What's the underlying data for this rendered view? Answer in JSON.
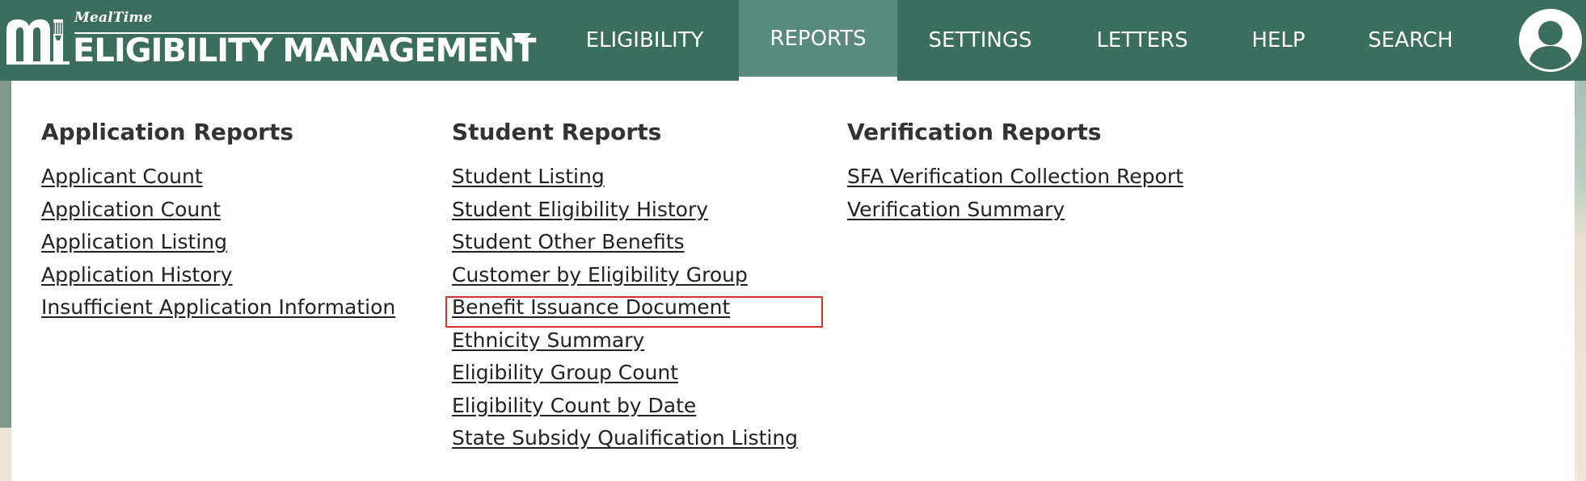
{
  "brand": {
    "small_text": "MealTime",
    "title": "ELIGIBILITY MANAGEMENT",
    "logo_icon": "mealtime-logo-icon",
    "caret_icon": "caret-down-icon"
  },
  "nav": {
    "items": [
      {
        "label": "ELIGIBILITY",
        "active": false
      },
      {
        "label": "REPORTS",
        "active": true
      },
      {
        "label": "SETTINGS",
        "active": false
      },
      {
        "label": "LETTERS",
        "active": false
      },
      {
        "label": "HELP",
        "active": false
      },
      {
        "label": "SEARCH",
        "active": false
      }
    ],
    "avatar_icon": "user-avatar-icon"
  },
  "menu": {
    "columns": [
      {
        "heading": "Application Reports",
        "links": [
          "Applicant Count",
          "Application Count",
          "Application Listing",
          "Application History",
          "Insufficient Application Information"
        ]
      },
      {
        "heading": "Student Reports",
        "links": [
          "Student Listing",
          "Student Eligibility History",
          "Student Other Benefits",
          "Customer by Eligibility Group",
          "Benefit Issuance Document",
          "Ethnicity Summary",
          "Eligibility Group Count",
          "Eligibility Count by Date",
          "State Subsidy Qualification Listing"
        ]
      },
      {
        "heading": "Verification Reports",
        "links": [
          "SFA Verification Collection Report",
          "Verification Summary"
        ]
      }
    ],
    "highlighted_link": "Benefit Issuance Document"
  },
  "colors": {
    "navbar": "#3c6e60",
    "nav_active": "#5a8a7d",
    "highlight_border": "#d8322d"
  }
}
